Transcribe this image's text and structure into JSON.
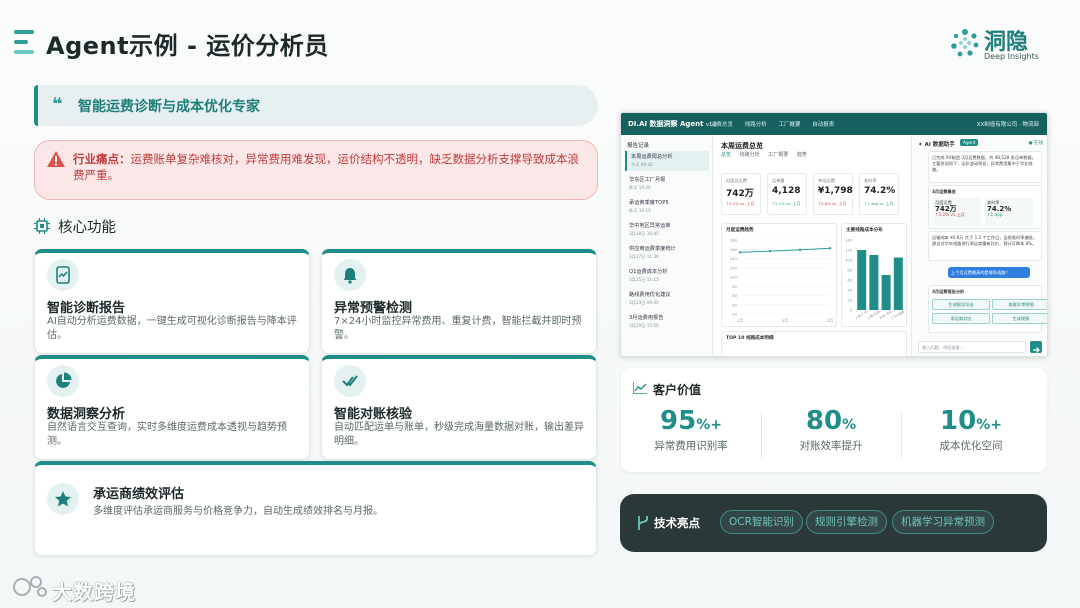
{
  "page": {
    "title": "Agent示例 - 运价分析员",
    "brand_name": "洞隐",
    "brand_sub": "Deep Insights"
  },
  "banner": {
    "quote_icon": "quote-icon",
    "text": "智能运费诊断与成本优化专家"
  },
  "pain_point": {
    "label": "行业痛点：",
    "text": "运费账单复杂难核对，异常费用难发现，运价结构不透明，缺乏数据分析支撑导致成本浪费严重。"
  },
  "core": {
    "title": "核心功能",
    "features": [
      {
        "icon": "report-icon",
        "title": "智能诊断报告",
        "desc": "AI自动分析运费数据，一键生成可视化诊断报告与降本评估。"
      },
      {
        "icon": "bell-icon",
        "title": "异常预警检测",
        "desc": "7×24小时监控异常费用、重复计费，智能拦截并即时预警。"
      },
      {
        "icon": "pie-chart-icon",
        "title": "数据洞察分析",
        "desc": "自然语言交互查询，实时多维度运费成本透视与趋势预测。"
      },
      {
        "icon": "check-double-icon",
        "title": "智能对账核验",
        "desc": "自动匹配运单与账单，秒级完成海量数据对账，输出差异明细。"
      },
      {
        "icon": "star-icon",
        "title": "承运商绩效评估",
        "desc": "多维度评估承运商服务与价格竞争力，自动生成绩效排名与月报。"
      }
    ]
  },
  "dashboard": {
    "brand": "DI.AI 数据洞察 Agent",
    "version": "v1.0",
    "nav": [
      "运费总览",
      "线路分析",
      "工厂概要",
      "自动报表"
    ],
    "user": "XX制造有限公司 · 物流部",
    "sidebar_head": "报告记录",
    "sidebar": [
      {
        "title": "本周运费周总分析",
        "sub": "今天 09:42"
      },
      {
        "title": "华东区工厂月报",
        "sub": "昨天 14:20"
      },
      {
        "title": "承运商季度TOP5",
        "sub": "昨天 10:15"
      },
      {
        "title": "华中地区异常运单",
        "sub": "3月28日 16:45"
      },
      {
        "title": "供应商运费季度统计",
        "sub": "3月27日 11:30"
      },
      {
        "title": "Q1运费成本分析",
        "sub": "3月25日 11:15"
      },
      {
        "title": "路线费用优化建议",
        "sub": "3月23日 09:00"
      },
      {
        "title": "3月运费用报告",
        "sub": "3月20日 15:50"
      }
    ],
    "main_title": "本周运费总览",
    "tabs": [
      "总览",
      "线路分析",
      "工厂概要",
      "趋势"
    ],
    "kpis": [
      {
        "label": "月度总运费",
        "value": "742万",
        "delta": "↑3.2% vs. 上月",
        "good": false
      },
      {
        "label": "运单量",
        "value": "4,128",
        "delta": "↑2.1% vs. 上月",
        "good": true
      },
      {
        "label": "单均运费",
        "value": "¥1,798",
        "delta": "↑0.8% vs. 上月",
        "good": false
      },
      {
        "label": "准时率",
        "value": "74.2%",
        "delta": "↑1.4pp vs. 上月",
        "good": true
      }
    ],
    "trend_title": "月度运费趋势",
    "trend_yticks": [
      "180",
      "160",
      "140",
      "120",
      "100",
      "80",
      "60",
      "40",
      "20"
    ],
    "trend_xticks": [
      "1月",
      "2月",
      "3月"
    ],
    "trend_values": [
      150,
      153,
      156,
      160
    ],
    "bar_title": "主要线路成本分布",
    "bar_values": [
      120,
      110,
      70,
      105
    ],
    "bar_xticks": [
      "上海-广州",
      "上海-北京",
      "北京-深圳",
      "广州-成都"
    ],
    "bottom_title": "TOP 10 线路成本明细",
    "chat_head": "AI 数据助手",
    "chat_tag": "Agent",
    "chat_online": "● 在线",
    "chat_msgs": [
      "已完成 XX制造 3月运费数据，共 48,528 条运单数据。主要发现如下：运价波动明显，异常费用集中于华北线路。",
      "3月运费概览",
      "运输成本 ¥4.8万 大于 1.2 个工作日，当前准时率偏低，建议对华东线路进行承运商重新比价，预计可降本 8%。"
    ],
    "chat_stats": [
      {
        "label": "月度运费",
        "value": "742万",
        "delta": "↑3.2% vs.上月"
      },
      {
        "label": "准时率",
        "value": "74.2%",
        "delta": "↑1.4pp"
      }
    ],
    "user_msg": "上个月运费最高的是哪条线路？",
    "chat_section": "3月运费报告分析",
    "chat_buttons": [
      "生成报告导出",
      "查看异常明细",
      "承运商对比",
      "生成周报"
    ],
    "chat_placeholder": "输入问题，例如查看…"
  },
  "value": {
    "title": "客户价值",
    "metrics": [
      {
        "value": "95",
        "unit": "%+",
        "label": "异常费用识别率"
      },
      {
        "value": "80",
        "unit": "%",
        "label": "对账效率提升"
      },
      {
        "value": "10",
        "unit": "%+",
        "label": "成本优化空间"
      }
    ]
  },
  "tech": {
    "title": "技术亮点",
    "pills": [
      "OCR智能识别",
      "规则引擎检测",
      "机器学习异常预测"
    ]
  },
  "watermark": {
    "text": "大数跨境"
  },
  "colors": {
    "accent": "#1f8d88",
    "danger": "#c23b3b",
    "dark": "#2b3838"
  }
}
